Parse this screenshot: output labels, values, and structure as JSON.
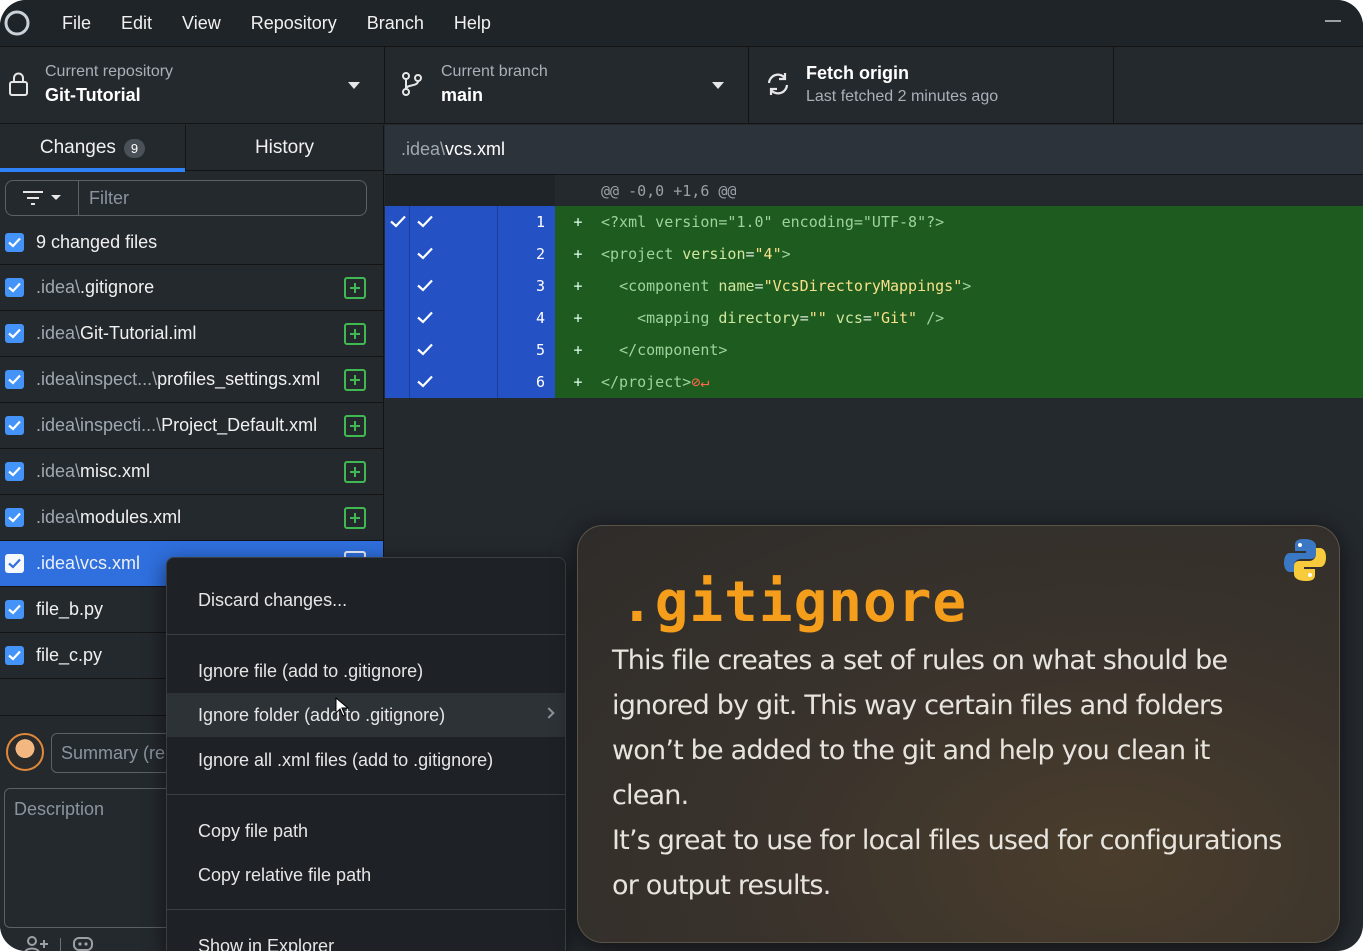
{
  "menubar": {
    "items": [
      "File",
      "Edit",
      "View",
      "Repository",
      "Branch",
      "Help"
    ]
  },
  "toolbar": {
    "repo": {
      "label": "Current repository",
      "value": "Git-Tutorial"
    },
    "branch": {
      "label": "Current branch",
      "value": "main"
    },
    "fetch": {
      "label": "Fetch origin",
      "value": "Last fetched 2 minutes ago"
    }
  },
  "sidebar": {
    "tabs": [
      {
        "label": "Changes",
        "badge": "9"
      },
      {
        "label": "History"
      }
    ],
    "filter_placeholder": "Filter",
    "all_files_label": "9 changed files",
    "files": [
      {
        "dir": ".idea\\",
        "name": ".gitignore"
      },
      {
        "dir": ".idea\\",
        "name": "Git-Tutorial.iml"
      },
      {
        "dir": ".idea\\inspect...\\",
        "name": "profiles_settings.xml"
      },
      {
        "dir": ".idea\\inspecti...\\",
        "name": "Project_Default.xml"
      },
      {
        "dir": ".idea\\",
        "name": "misc.xml"
      },
      {
        "dir": ".idea\\",
        "name": "modules.xml"
      },
      {
        "dir": ".idea\\",
        "name": "vcs.xml"
      },
      {
        "dir": "",
        "name": "file_b.py"
      },
      {
        "dir": "",
        "name": "file_c.py"
      }
    ],
    "summary_placeholder": "Summary (re",
    "description_placeholder": "Description"
  },
  "diff": {
    "header_dir": ".idea\\",
    "header_file": "vcs.xml",
    "hunk": "@@ -0,0 +1,6 @@",
    "lines": [
      {
        "num": "1",
        "sign": "+"
      },
      {
        "num": "2",
        "sign": "+"
      },
      {
        "num": "3",
        "sign": "+"
      },
      {
        "num": "4",
        "sign": "+"
      },
      {
        "num": "5",
        "sign": "+"
      },
      {
        "num": "6",
        "sign": "+"
      }
    ],
    "code": {
      "l1": "<?xml version=\"1.0\" encoding=\"UTF-8\"?>",
      "l2_tag": "<project",
      "l2_attr": "version",
      "l2_val": "\"4\"",
      "l3_tag": "<component",
      "l3_attr": "name",
      "l3_val": "\"VcsDirectoryMappings\"",
      "l4_tag": "<mapping",
      "l4_attr1": "directory",
      "l4_val1": "\"\"",
      "l4_attr2": "vcs",
      "l4_val2": "\"Git\"",
      "l5": "</component>",
      "l6": "</project>",
      "l6_marker": "⊘↵"
    }
  },
  "context_menu": {
    "items": [
      "Discard changes...",
      "Ignore file (add to .gitignore)",
      "Ignore folder (add to .gitignore)",
      "Ignore all .xml files (add to .gitignore)",
      "Copy file path",
      "Copy relative file path",
      "Show in Explorer"
    ]
  },
  "overlay": {
    "title": ".gitignore",
    "body_lines": [
      "This file creates a set of rules on what should be",
      "ignored by git. This way certain files and folders",
      "won’t be added to the git and help you clean it",
      "clean.",
      "It’s great to use for local files used for configurations",
      "or output results."
    ]
  },
  "colors": {
    "accent": "#2f81f7",
    "added": "#3fb950",
    "diff_added_bg": "#1e5b1e",
    "gutter_selected": "#2451c3",
    "overlay_title": "#f59e1b"
  }
}
